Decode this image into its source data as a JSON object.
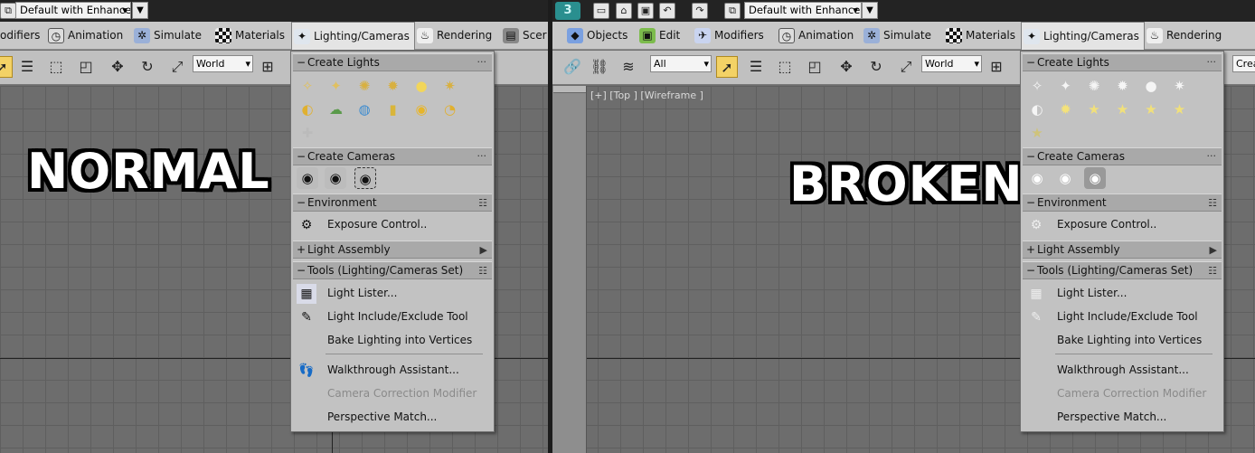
{
  "left": {
    "label": "NORMAL",
    "quick_access": {
      "workspace": "Default with Enhance",
      "arrow": "▾",
      "menu_btn": "▼"
    },
    "tabs": [
      "odifiers",
      "Animation",
      "Simulate",
      "Materials",
      "Lighting/Cameras",
      "Rendering",
      "Scer"
    ],
    "toolbar": {
      "coord_system": "World"
    },
    "panel": {
      "create_lights": "Create Lights",
      "light_icons": [
        "target-spot-icon",
        "free-spot-icon",
        "target-direct-icon",
        "free-direct-icon",
        "omni-icon",
        "skylight-icon",
        "mr-area-spot-icon",
        "mr-sky-portal-icon",
        "sun-positioner-icon",
        "photometric-web-icon",
        "mr-area-omni-icon",
        "daylight-icon",
        "light-add-icon"
      ],
      "create_cameras": "Create Cameras",
      "environment": "Environment",
      "exposure": "Exposure Control..",
      "light_assembly": "Light Assembly",
      "tools": "Tools (Lighting/Cameras Set)",
      "items": [
        "Light Lister...",
        "Light Include/Exclude Tool",
        "Bake Lighting into Vertices",
        "Walkthrough Assistant...",
        "Camera Correction Modifier",
        "Perspective Match..."
      ]
    }
  },
  "right": {
    "label": "BROKEN",
    "quick_access": {
      "workspace": "Default with Enhance",
      "arrow": "▾",
      "menu_btn": "▼"
    },
    "tabs": [
      "Objects",
      "Edit",
      "Modifiers",
      "Animation",
      "Simulate",
      "Materials",
      "Lighting/Cameras",
      "Rendering"
    ],
    "toolbar": {
      "filter": "All",
      "coord_system": "World",
      "named_sel": "Crea"
    },
    "viewport_label": "[+] [Top ] [Wireframe ]",
    "panel": {
      "create_lights": "Create Lights",
      "light_icons": [
        "target-spot-icon",
        "free-spot-icon",
        "target-direct-icon",
        "free-direct-icon",
        "omni-icon",
        "skylight-icon",
        "mr-area-spot-icon",
        "sunlight-icon",
        "star-icon",
        "star-icon",
        "star-icon",
        "star-icon",
        "star-dim-icon"
      ],
      "create_cameras": "Create Cameras",
      "environment": "Environment",
      "exposure": "Exposure Control..",
      "light_assembly": "Light Assembly",
      "tools": "Tools (Lighting/Cameras Set)",
      "items": [
        "Light Lister...",
        "Light Include/Exclude Tool",
        "Bake Lighting into Vertices",
        "Walkthrough Assistant...",
        "Camera Correction Modifier",
        "Perspective Match..."
      ]
    }
  },
  "colors": {
    "active_tool": "#f3d266",
    "panel": "#c2c2c2",
    "panel_header": "#a9a9a9",
    "viewport": "#6d6d6d"
  }
}
